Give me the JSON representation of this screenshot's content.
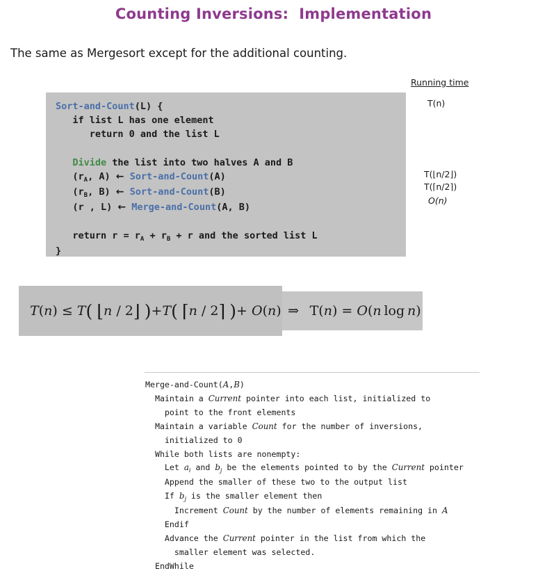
{
  "slide": {
    "title": "Counting Inversions:  Implementation",
    "subtitle": "The same as Mergesort except for the additional counting."
  },
  "colors": {
    "title_purple": "#8e3a8e",
    "code_keyword_blue": "#4a6fa8",
    "code_keyword_green": "#3f8a44",
    "code_box_gray": "#c3c3c3",
    "equation_box_gray": "#c0c0c0",
    "text_black": "#1a1a1a"
  },
  "running_time": {
    "heading": "Running time",
    "items": [
      "T(n)",
      "T(⌊n/2⌋)",
      "T(⌈n/2⌉)",
      "O(n)"
    ]
  },
  "code_block": {
    "lines": [
      "Sort-and-Count(L) {",
      "   if list L has one element",
      "      return 0 and the list L",
      "",
      "   Divide the list into two halves A and B",
      "   (rA, A) ← Sort-and-Count(A)",
      "   (rB, B) ← Sort-and-Count(B)",
      "   (r , L) ← Merge-and-Count(A, B)",
      "",
      "   return r = rA + rB + r and the sorted list L",
      "}"
    ],
    "keywords_blue": [
      "Sort-and-Count",
      "Merge-and-Count"
    ],
    "keywords_green": [
      "Divide"
    ]
  },
  "equation": {
    "left": "T(n) ≤ T( ⌊n / 2⌋ ) + T( ⌈n / 2⌉ ) + O(n)",
    "implies": "⇒",
    "right": "T(n) = O(n log n)"
  },
  "pseudocode": {
    "lines": [
      "Merge-and-Count(A,B)",
      "  Maintain a Current pointer into each list, initialized to",
      "    point to the front elements",
      "  Maintain a variable Count for the number of inversions,",
      "    initialized to 0",
      "  While both lists are nonempty:",
      "    Let ai and bj be the elements pointed to by the Current pointer",
      "    Append the smaller of these two to the output list",
      "    If bj is the smaller element then",
      "      Increment Count by the number of elements remaining in A",
      "    Endif",
      "    Advance the Current pointer in the list from which the",
      "      smaller element was selected.",
      "  EndWhile"
    ],
    "italic_terms": [
      "Current",
      "Count",
      "A",
      "B",
      "ai",
      "bj"
    ]
  }
}
